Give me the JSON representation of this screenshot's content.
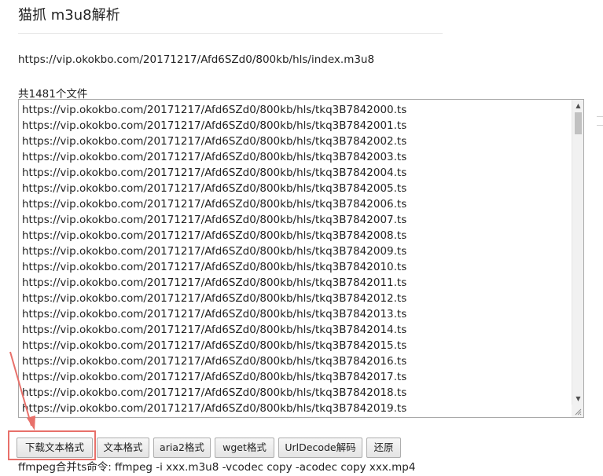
{
  "page": {
    "title": "猫抓 m3u8解析",
    "source_url": "https://vip.okokbo.com/20171217/Afd6SZd0/800kb/hls/index.m3u8",
    "file_count_label": "共1481个文件"
  },
  "file_list": [
    "https://vip.okokbo.com/20171217/Afd6SZd0/800kb/hls/tkq3B7842000.ts",
    "https://vip.okokbo.com/20171217/Afd6SZd0/800kb/hls/tkq3B7842001.ts",
    "https://vip.okokbo.com/20171217/Afd6SZd0/800kb/hls/tkq3B7842002.ts",
    "https://vip.okokbo.com/20171217/Afd6SZd0/800kb/hls/tkq3B7842003.ts",
    "https://vip.okokbo.com/20171217/Afd6SZd0/800kb/hls/tkq3B7842004.ts",
    "https://vip.okokbo.com/20171217/Afd6SZd0/800kb/hls/tkq3B7842005.ts",
    "https://vip.okokbo.com/20171217/Afd6SZd0/800kb/hls/tkq3B7842006.ts",
    "https://vip.okokbo.com/20171217/Afd6SZd0/800kb/hls/tkq3B7842007.ts",
    "https://vip.okokbo.com/20171217/Afd6SZd0/800kb/hls/tkq3B7842008.ts",
    "https://vip.okokbo.com/20171217/Afd6SZd0/800kb/hls/tkq3B7842009.ts",
    "https://vip.okokbo.com/20171217/Afd6SZd0/800kb/hls/tkq3B7842010.ts",
    "https://vip.okokbo.com/20171217/Afd6SZd0/800kb/hls/tkq3B7842011.ts",
    "https://vip.okokbo.com/20171217/Afd6SZd0/800kb/hls/tkq3B7842012.ts",
    "https://vip.okokbo.com/20171217/Afd6SZd0/800kb/hls/tkq3B7842013.ts",
    "https://vip.okokbo.com/20171217/Afd6SZd0/800kb/hls/tkq3B7842014.ts",
    "https://vip.okokbo.com/20171217/Afd6SZd0/800kb/hls/tkq3B7842015.ts",
    "https://vip.okokbo.com/20171217/Afd6SZd0/800kb/hls/tkq3B7842016.ts",
    "https://vip.okokbo.com/20171217/Afd6SZd0/800kb/hls/tkq3B7842017.ts",
    "https://vip.okokbo.com/20171217/Afd6SZd0/800kb/hls/tkq3B7842018.ts",
    "https://vip.okokbo.com/20171217/Afd6SZd0/800kb/hls/tkq3B7842019.ts"
  ],
  "toolbar": {
    "download_text_label": "下载文本格式",
    "text_format_label": "文本格式",
    "aria2_label": "aria2格式",
    "wget_label": "wget格式",
    "urldecode_label": "UrlDecode解码",
    "restore_label": "还原"
  },
  "ffmpeg_command": "ffmpeg合并ts命令: ffmpeg -i xxx.m3u8 -vcodec copy -acodec copy xxx.mp4",
  "icons": {
    "scroll_up": "triangle-up-icon",
    "scroll_down": "triangle-down-icon",
    "resize": "resize-grip-icon",
    "annotation": "arrow-icon"
  },
  "colors": {
    "annotation": "#e8706a",
    "border": "#a9a9a9",
    "scroll_thumb": "#c1c1c1"
  }
}
